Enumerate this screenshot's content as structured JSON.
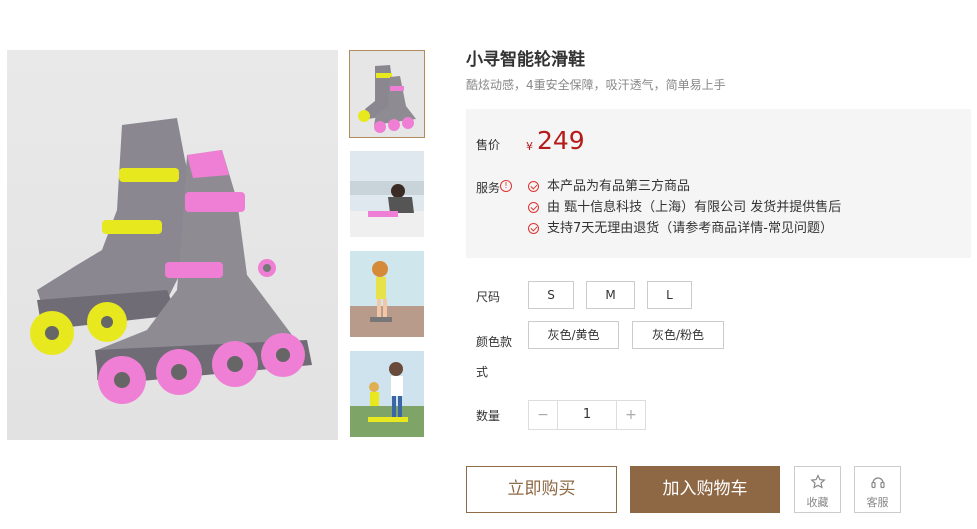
{
  "product": {
    "title": "小寻智能轮滑鞋",
    "subtitle": "酷炫动感，4重安全保障，吸汗透气，简单易上手"
  },
  "price": {
    "label": "售价",
    "currency": "¥",
    "value": "249"
  },
  "services": {
    "label": "服务",
    "items": [
      "本产品为有品第三方商品",
      "由 甄十信息科技（上海）有限公司 发货并提供售后",
      "支持7天无理由退货（请参考商品详情-常见问题）"
    ]
  },
  "size": {
    "label": "尺码",
    "options": [
      "S",
      "M",
      "L"
    ]
  },
  "color": {
    "label": "颜色款式",
    "options": [
      "灰色/黄色",
      "灰色/粉色"
    ]
  },
  "quantity": {
    "label": "数量",
    "value": "1",
    "minus": "−",
    "plus": "+"
  },
  "actions": {
    "buy_now": "立即购买",
    "add_to_cart": "加入购物车",
    "favorite": "收藏",
    "customer_service": "客服"
  },
  "colors": {
    "brand": "#8e6845",
    "price": "#b51b1b",
    "skate_gray": "#8a8790",
    "skate_yellow": "#e8e81f",
    "skate_pink": "#ef7fd4"
  }
}
